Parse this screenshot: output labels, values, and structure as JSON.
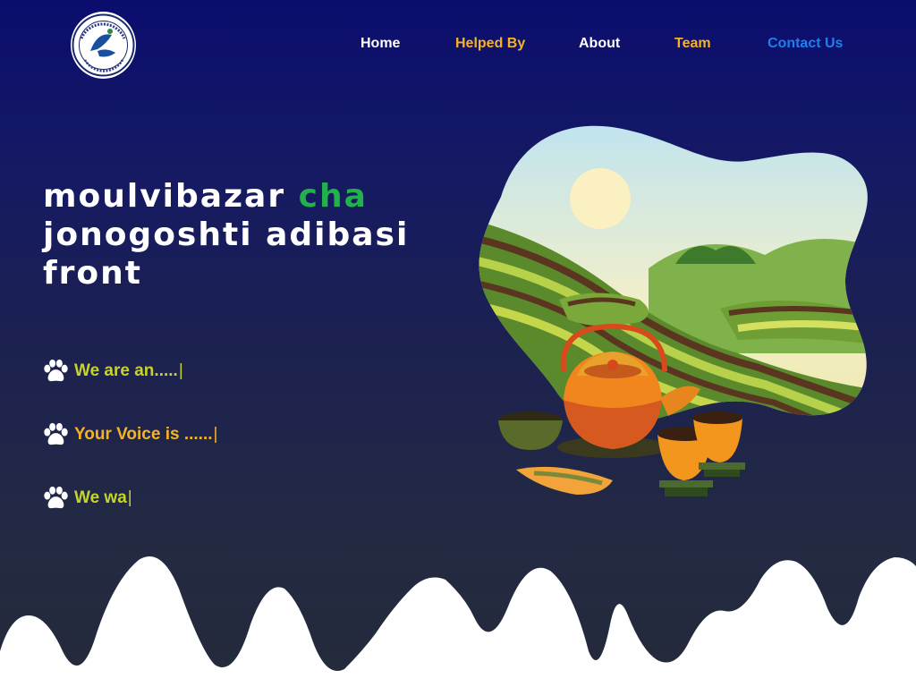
{
  "logo": {
    "icon": "organization-seal-logo",
    "caption": "মৌলভীবাজার চা জনগোষ্ঠী আদিবাসী ফ্রন্ট"
  },
  "nav": {
    "items": [
      {
        "label": "Home",
        "color": "#ffffff"
      },
      {
        "label": "Helped By",
        "color": "#f5b324"
      },
      {
        "label": "About",
        "color": "#ffffff"
      },
      {
        "label": "Team",
        "color": "#f5b324"
      },
      {
        "label": "Contact Us",
        "color": "#1e7ff0"
      }
    ]
  },
  "hero": {
    "title_part1": "moulvibazar",
    "title_accent": "cha",
    "title_line2": "jonogoshti adibasi",
    "title_line3": "front",
    "accent_color": "#21b24a"
  },
  "taglines": [
    {
      "text": "We are an.....",
      "cursor": "|",
      "color": "#c5d32c",
      "icon": "paw-icon"
    },
    {
      "text": "Your Voice is ......",
      "cursor": "|",
      "color": "#f5b324",
      "icon": "paw-icon"
    },
    {
      "text": "We wa",
      "cursor": "|",
      "color": "#c5d32c",
      "icon": "paw-icon"
    }
  ],
  "illustration": {
    "subject": "tea-garden-teapot-illustration"
  },
  "colors": {
    "bg_top": "#0b0d6e",
    "bg_bottom": "#252b3a",
    "mountains": "#ffffff"
  }
}
